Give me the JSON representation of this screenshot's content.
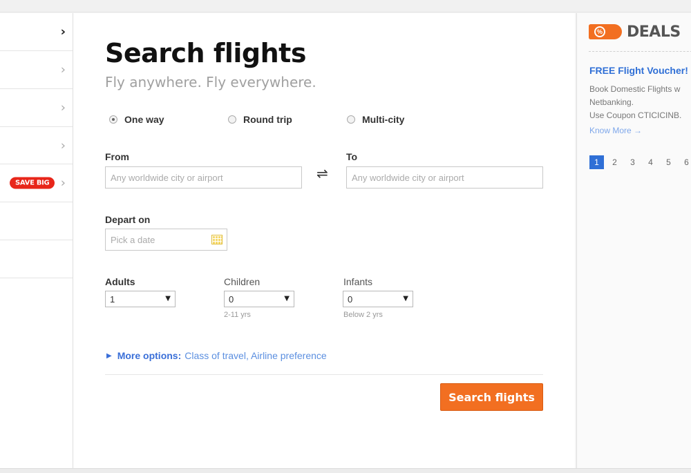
{
  "left_nav": {
    "save_badge": "SAVE BIG"
  },
  "main": {
    "title": "Search flights",
    "subtitle": "Fly anywhere. Fly everywhere.",
    "trip_types": [
      {
        "label": "One way",
        "selected": true
      },
      {
        "label": "Round trip",
        "selected": false
      },
      {
        "label": "Multi-city",
        "selected": false
      }
    ],
    "from": {
      "label": "From",
      "placeholder": "Any worldwide city or airport"
    },
    "to": {
      "label": "To",
      "placeholder": "Any worldwide city or airport"
    },
    "swap_icon": "⇌",
    "depart": {
      "label": "Depart on",
      "placeholder": "Pick a date"
    },
    "adults": {
      "label": "Adults",
      "value": "1"
    },
    "children": {
      "label": "Children",
      "value": "0",
      "hint": "2-11 yrs"
    },
    "infants": {
      "label": "Infants",
      "value": "0",
      "hint": "Below 2 yrs"
    },
    "more_options": {
      "label": "More options:",
      "detail": "Class of travel, Airline preference"
    },
    "search_button": "Search flights",
    "colors": {
      "accent": "#f26f21",
      "link": "#3a6fd8"
    }
  },
  "deals": {
    "tag_icon": "%",
    "title": "DEALS",
    "deal_title": "FREE Flight Voucher!",
    "lines": [
      "Book Domestic Flights w",
      "Netbanking.",
      "Use Coupon CTICICINB."
    ],
    "link": "Know More →",
    "pages": [
      "1",
      "2",
      "3",
      "4",
      "5",
      "6"
    ],
    "current_page": "1"
  }
}
